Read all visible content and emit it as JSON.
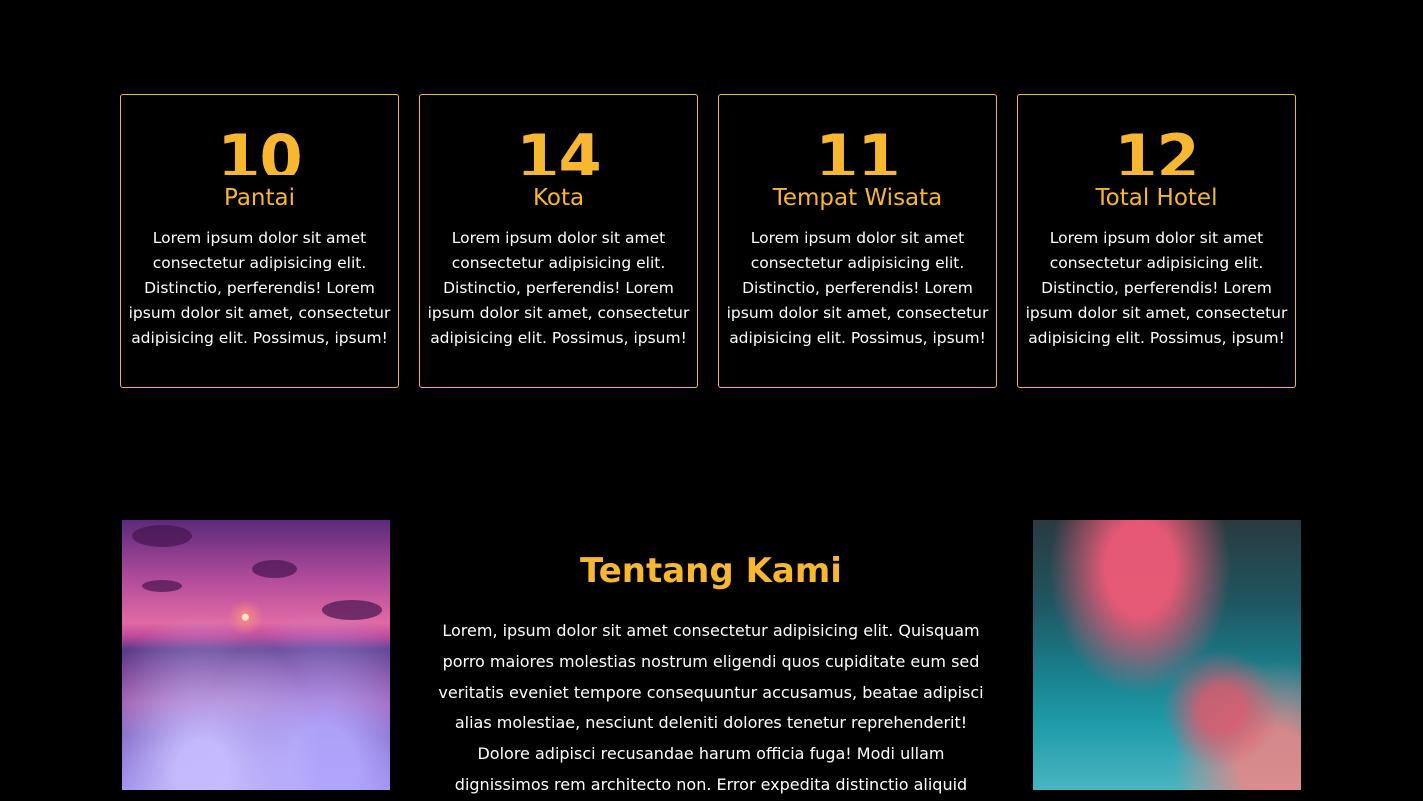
{
  "stats": [
    {
      "number": "10",
      "label": "Pantai",
      "description": "Lorem ipsum dolor sit amet consectetur adipisicing elit. Distinctio, perferendis! Lorem ipsum dolor sit amet, consectetur adipisicing elit. Possimus, ipsum!"
    },
    {
      "number": "14",
      "label": "Kota",
      "description": "Lorem ipsum dolor sit amet consectetur adipisicing elit. Distinctio, perferendis! Lorem ipsum dolor sit amet, consectetur adipisicing elit. Possimus, ipsum!"
    },
    {
      "number": "11",
      "label": "Tempat Wisata",
      "description": "Lorem ipsum dolor sit amet consectetur adipisicing elit. Distinctio, perferendis! Lorem ipsum dolor sit amet, consectetur adipisicing elit. Possimus, ipsum!"
    },
    {
      "number": "12",
      "label": "Total Hotel",
      "description": "Lorem ipsum dolor sit amet consectetur adipisicing elit. Distinctio, perferendis! Lorem ipsum dolor sit amet, consectetur adipisicing elit. Possimus, ipsum!"
    }
  ],
  "about": {
    "title": "Tentang Kami",
    "text": "Lorem, ipsum dolor sit amet consectetur adipisicing elit. Quisquam porro maiores molestias nostrum eligendi quos cupiditate eum sed veritatis eveniet tempore consequuntur accusamus, beatae adipisci alias molestiae, nesciunt deleniti dolores tenetur reprehenderit! Dolore adipisci recusandae harum officia fuga! Modi ullam dignissimos rem architecto non. Error expedita distinctio aliquid"
  },
  "colors": {
    "accent": "#f7b731",
    "background": "#000000",
    "text": "#ffffff"
  }
}
